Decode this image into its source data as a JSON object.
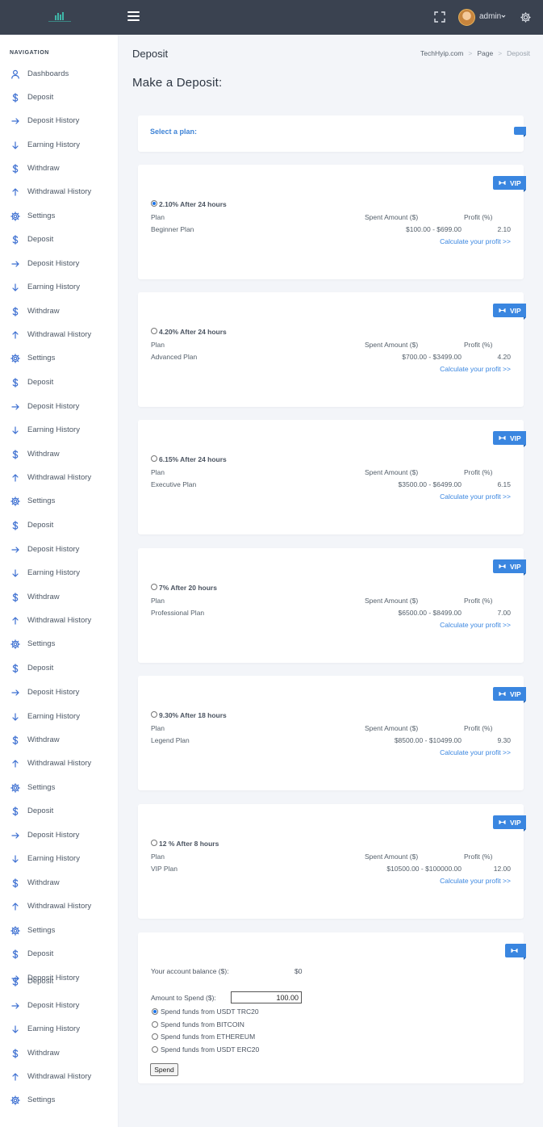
{
  "header": {
    "user_name": "admin",
    "icons": [
      "menu-icon",
      "fullscreen-icon",
      "chevron-down-icon",
      "gear-icon"
    ]
  },
  "sidebar": {
    "title": "NAVIGATION",
    "items": [
      {
        "label": "Dashboards",
        "icon": "user-icon"
      },
      {
        "label": "Deposit",
        "icon": "dollar-icon"
      },
      {
        "label": "Deposit History",
        "icon": "arrow-right-icon"
      },
      {
        "label": "Earning History",
        "icon": "arrow-down-icon"
      },
      {
        "label": "Withdraw",
        "icon": "dollar-icon"
      },
      {
        "label": "Withdrawal History",
        "icon": "arrow-up-icon"
      },
      {
        "label": "Settings",
        "icon": "gear-icon"
      },
      {
        "label": "Deposit",
        "icon": "dollar-icon"
      },
      {
        "label": "Deposit History",
        "icon": "arrow-right-icon"
      },
      {
        "label": "Earning History",
        "icon": "arrow-down-icon"
      },
      {
        "label": "Withdraw",
        "icon": "dollar-icon"
      },
      {
        "label": "Withdrawal History",
        "icon": "arrow-up-icon"
      },
      {
        "label": "Settings",
        "icon": "gear-icon"
      },
      {
        "label": "Deposit",
        "icon": "dollar-icon"
      },
      {
        "label": "Deposit History",
        "icon": "arrow-right-icon"
      },
      {
        "label": "Earning History",
        "icon": "arrow-down-icon"
      },
      {
        "label": "Withdraw",
        "icon": "dollar-icon"
      },
      {
        "label": "Withdrawal History",
        "icon": "arrow-up-icon"
      },
      {
        "label": "Settings",
        "icon": "gear-icon"
      },
      {
        "label": "Deposit",
        "icon": "dollar-icon"
      },
      {
        "label": "Deposit History",
        "icon": "arrow-right-icon"
      },
      {
        "label": "Earning History",
        "icon": "arrow-down-icon"
      },
      {
        "label": "Withdraw",
        "icon": "dollar-icon"
      },
      {
        "label": "Withdrawal History",
        "icon": "arrow-up-icon"
      },
      {
        "label": "Settings",
        "icon": "gear-icon"
      },
      {
        "label": "Deposit",
        "icon": "dollar-icon"
      },
      {
        "label": "Deposit History",
        "icon": "arrow-right-icon"
      },
      {
        "label": "Earning History",
        "icon": "arrow-down-icon"
      },
      {
        "label": "Withdraw",
        "icon": "dollar-icon"
      },
      {
        "label": "Withdrawal History",
        "icon": "arrow-up-icon"
      },
      {
        "label": "Settings",
        "icon": "gear-icon"
      },
      {
        "label": "Deposit",
        "icon": "dollar-icon"
      },
      {
        "label": "Deposit History",
        "icon": "arrow-right-icon"
      },
      {
        "label": "Earning History",
        "icon": "arrow-down-icon"
      },
      {
        "label": "Withdraw",
        "icon": "dollar-icon"
      },
      {
        "label": "Withdrawal History",
        "icon": "arrow-up-icon"
      },
      {
        "label": "Settings",
        "icon": "gear-icon"
      },
      {
        "label": "Deposit",
        "icon": "dollar-icon"
      },
      {
        "label": "Deposit History",
        "icon": "arrow-right-icon"
      },
      {
        "label": "Deposit",
        "icon": "dollar-icon"
      },
      {
        "label": "Deposit History",
        "icon": "arrow-right-icon"
      },
      {
        "label": "Earning History",
        "icon": "arrow-down-icon"
      },
      {
        "label": "Withdraw",
        "icon": "dollar-icon"
      },
      {
        "label": "Withdrawal History",
        "icon": "arrow-up-icon"
      },
      {
        "label": "Settings",
        "icon": "gear-icon"
      }
    ]
  },
  "page": {
    "title": "Deposit",
    "breadcrumb": [
      "TechHyip.com",
      "Page",
      "Deposit"
    ],
    "heading": "Make a Deposit:",
    "select_plan_label": "Select a plan:"
  },
  "plan_headers": {
    "plan": "Plan",
    "spent": "Spent Amount ($)",
    "profit": "Profit (%)"
  },
  "plans": [
    {
      "title": "2.10% After 24 hours",
      "name": "Beginner Plan",
      "range": "$100.00 - $699.00",
      "profit": "2.10",
      "selected": true,
      "badge": "VIP",
      "calc": "Calculate your profit >>"
    },
    {
      "title": "4.20% After 24 hours",
      "name": "Advanced Plan",
      "range": "$700.00 - $3499.00",
      "profit": "4.20",
      "selected": false,
      "badge": "VIP",
      "calc": "Calculate your profit >>"
    },
    {
      "title": "6.15% After 24 hours",
      "name": "Executive Plan",
      "range": "$3500.00 - $6499.00",
      "profit": "6.15",
      "selected": false,
      "badge": "VIP",
      "calc": "Calculate your profit >>"
    },
    {
      "title": "7% After 20 hours",
      "name": "Professional Plan",
      "range": "$6500.00 - $8499.00",
      "profit": "7.00",
      "selected": false,
      "badge": "VIP",
      "calc": "Calculate your profit >>"
    },
    {
      "title": "9.30% After 18 hours",
      "name": "Legend Plan",
      "range": "$8500.00 - $10499.00",
      "profit": "9.30",
      "selected": false,
      "badge": "VIP",
      "calc": "Calculate your profit >>"
    },
    {
      "title": "12 % After 8 hours",
      "name": "VIP Plan",
      "range": "$10500.00 - $100000.00",
      "profit": "12.00",
      "selected": false,
      "badge": "VIP",
      "calc": "Calculate your profit >>"
    }
  ],
  "payment": {
    "balance_label": "Your account balance ($):",
    "balance_value": "$0",
    "amount_label": "Amount to Spend ($):",
    "amount_value": "100.00",
    "options": [
      {
        "label": "Spend funds from USDT TRC20",
        "selected": true
      },
      {
        "label": "Spend funds from BITCOIN",
        "selected": false
      },
      {
        "label": "Spend funds from ETHEREUM",
        "selected": false
      },
      {
        "label": "Spend funds from USDT ERC20",
        "selected": false
      }
    ],
    "submit_label": "Spend"
  },
  "colors": {
    "accent": "#3a86e0",
    "topbar": "#3a4250",
    "background": "#f3f5f9"
  }
}
